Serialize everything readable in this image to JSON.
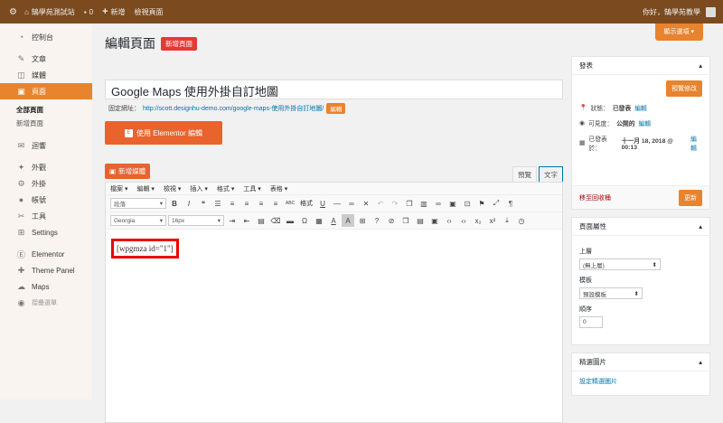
{
  "adminbar": {
    "site_name": "鵠學苑測試站",
    "comments_count": "0",
    "new_label": "新增",
    "view_page": "檢視頁面",
    "greeting": "你好，鵠學苑教學"
  },
  "sidebar": {
    "items": [
      {
        "icon": "◔",
        "label": "控制台"
      },
      {
        "icon": "✎",
        "label": "文章"
      },
      {
        "icon": "◫",
        "label": "媒體"
      },
      {
        "icon": "▣",
        "label": "頁面"
      },
      {
        "icon": "✉",
        "label": "迴響"
      },
      {
        "icon": "✦",
        "label": "外觀"
      },
      {
        "icon": "⚙",
        "label": "外掛"
      },
      {
        "icon": "●",
        "label": "帳號"
      },
      {
        "icon": "✂",
        "label": "工具"
      },
      {
        "icon": "⊞",
        "label": "Settings"
      },
      {
        "icon": "Ⓔ",
        "label": "Elementor"
      },
      {
        "icon": "✚",
        "label": "Theme Panel"
      },
      {
        "icon": "☁",
        "label": "Maps"
      },
      {
        "icon": "◉",
        "label": "摺疊選單"
      }
    ],
    "submenu": [
      "全部頁面",
      "新增頁面"
    ]
  },
  "page": {
    "title": "編輯頁面",
    "add_new": "新增頁面",
    "screen_options": "顯示選項 ▾",
    "post_title": "Google Maps 使用外掛自訂地圖",
    "permalink_label": "固定網址：",
    "permalink_base": "http://scott.designhu-demo.com/",
    "permalink_slug": "google-maps-使用外掛自訂地圖/",
    "edit_label": "編輯",
    "elementor_label": "使用 Elementor 編輯"
  },
  "editor": {
    "add_media": "新增媒體",
    "tab_visual": "預覽",
    "tab_text": "文字",
    "menus": [
      "檔案 ▾",
      "編輯 ▾",
      "檢視 ▾",
      "插入 ▾",
      "格式 ▾",
      "工具 ▾",
      "表格 ▾"
    ],
    "paragraph_select": "段落",
    "font_select": "Georgia",
    "size_select": "16px",
    "format_label": "格式",
    "content": "[wpgmza id=\"1\"]"
  },
  "publish": {
    "title": "發表",
    "preview_btn": "預覽修改",
    "status_label": "狀態：",
    "status_value": "已發表",
    "visibility_label": "可見度：",
    "visibility_value": "公開的",
    "published_label": "已發表於：",
    "published_value": "十一月 18, 2018 @ 00:13",
    "edit": "編輯",
    "trash": "移至回收桶",
    "update_btn": "更新"
  },
  "attributes": {
    "title": "頁面屬性",
    "parent_label": "上層",
    "parent_value": "(無上層)",
    "template_label": "模板",
    "template_value": "預設模板",
    "order_label": "順序",
    "order_value": "0"
  },
  "featured": {
    "title": "精選圖片",
    "set_link": "設定精選圖片"
  },
  "colors": {
    "adminbar": "#7b4a1e",
    "accent": "#e8832e",
    "highlight": "#e00000"
  }
}
